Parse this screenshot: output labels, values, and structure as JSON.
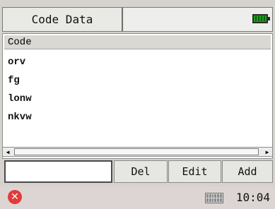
{
  "title": "Code Data",
  "list": {
    "header": "Code",
    "items": [
      "orv",
      "fg",
      "lonw",
      "nkvw"
    ]
  },
  "input": {
    "value": ""
  },
  "buttons": {
    "del": "Del",
    "edit": "Edit",
    "add": "Add"
  },
  "status": {
    "time": "10:04"
  },
  "icons": {
    "close": "close-icon",
    "battery": "battery-icon",
    "keyboard": "keyboard-icon"
  },
  "colors": {
    "battery_fill": "#1fa11f",
    "close_icon": "#e23b3b"
  }
}
